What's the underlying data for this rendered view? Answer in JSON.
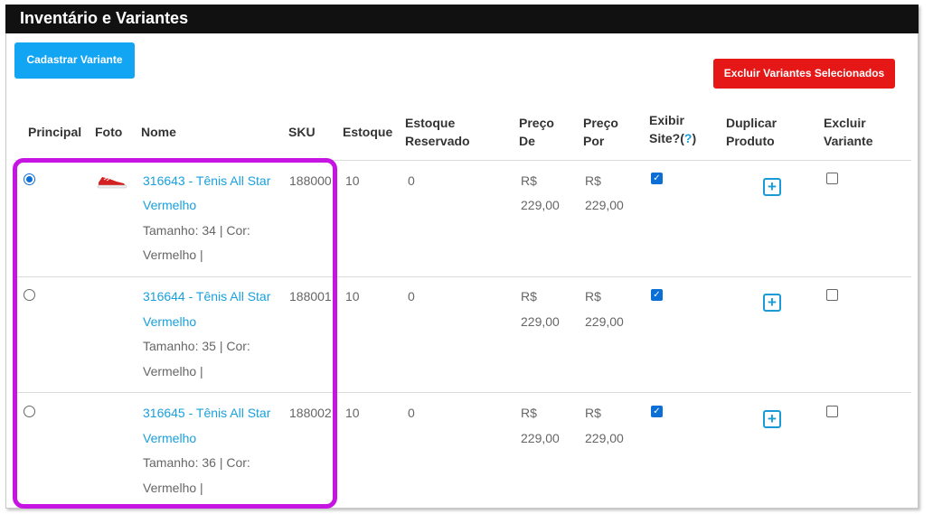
{
  "panel": {
    "title": "Inventário e Variantes"
  },
  "buttons": {
    "cadastrar": "Cadastrar Variante",
    "excluir_selecionados": "Excluir Variantes Selecionados"
  },
  "table": {
    "headers": {
      "principal": "Principal",
      "foto": "Foto",
      "nome": "Nome",
      "sku": "SKU",
      "estoque": "Estoque",
      "estoque_reservado_1": "Estoque",
      "estoque_reservado_2": "Reservado",
      "preco_de_1": "Preço",
      "preco_de_2": "De",
      "preco_por_1": "Preço",
      "preco_por_2": "Por",
      "exibir_1": "Exibir",
      "exibir_2": "Site?(",
      "exibir_help": "?",
      "exibir_close": ")",
      "duplicar_1": "Duplicar",
      "duplicar_2": "Produto",
      "excluir_1": "Excluir",
      "excluir_2": "Variante"
    },
    "rows": [
      {
        "principal_selected": true,
        "has_photo": true,
        "nome_link_1": "316643 - Tênis All Star",
        "nome_link_2": "Vermelho",
        "detalhe_1": "Tamanho: 34 | Cor:",
        "detalhe_2": "Vermelho |",
        "sku": "188000",
        "estoque": "10",
        "estoque_reservado": "0",
        "preco_de_currency": "R$",
        "preco_de_value": "229,00",
        "preco_por_currency": "R$",
        "preco_por_value": "229,00",
        "exibir_site": true,
        "excluir": false
      },
      {
        "principal_selected": false,
        "has_photo": false,
        "nome_link_1": "316644 - Tênis All Star",
        "nome_link_2": "Vermelho",
        "detalhe_1": "Tamanho: 35 | Cor:",
        "detalhe_2": "Vermelho |",
        "sku": "188001",
        "estoque": "10",
        "estoque_reservado": "0",
        "preco_de_currency": "R$",
        "preco_de_value": "229,00",
        "preco_por_currency": "R$",
        "preco_por_value": "229,00",
        "exibir_site": true,
        "excluir": false
      },
      {
        "principal_selected": false,
        "has_photo": false,
        "nome_link_1": "316645 - Tênis All Star",
        "nome_link_2": "Vermelho",
        "detalhe_1": "Tamanho: 36 | Cor:",
        "detalhe_2": "Vermelho |",
        "sku": "188002",
        "estoque": "10",
        "estoque_reservado": "0",
        "preco_de_currency": "R$",
        "preco_de_value": "229,00",
        "preco_por_currency": "R$",
        "preco_por_value": "229,00",
        "exibir_site": true,
        "excluir": false
      }
    ]
  },
  "colors": {
    "titlebar": "#111111",
    "primary_button": "#12a5f4",
    "danger_button": "#e51717",
    "link": "#1aa0dc",
    "highlight": "#c615e3"
  },
  "icons": {
    "duplicar": "plus-square-icon",
    "foto": "red-sneaker-thumbnail"
  }
}
